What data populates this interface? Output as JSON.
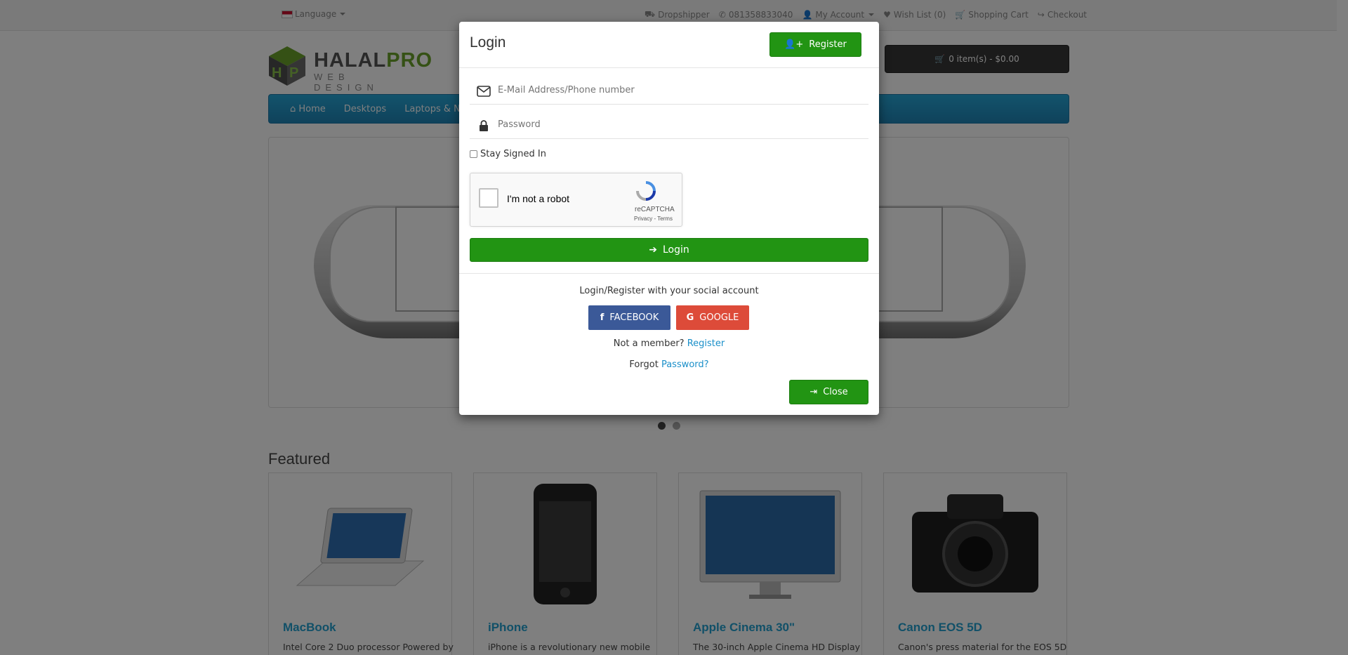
{
  "topbar": {
    "language": "Language",
    "dropshipper": "Dropshipper",
    "phone": "081358833040",
    "my_account": "My Account",
    "wishlist": "Wish List (0)",
    "shopping_cart": "Shopping Cart",
    "checkout": "Checkout"
  },
  "logo": {
    "word1": "HALAL",
    "word2": "PRO",
    "sub": "WEB DESIGN"
  },
  "cart": {
    "label": "0 item(s) - $0.00"
  },
  "menu": {
    "items": [
      "Home",
      "Desktops",
      "Laptops & Not"
    ]
  },
  "featured": {
    "title": "Featured",
    "products": [
      {
        "name": "MacBook",
        "desc": "Intel Core 2 Duo processor Powered by"
      },
      {
        "name": "iPhone",
        "desc": "iPhone is a revolutionary new mobile"
      },
      {
        "name": "Apple Cinema 30\"",
        "desc": "The 30-inch Apple Cinema HD Display"
      },
      {
        "name": "Canon EOS 5D",
        "desc": "Canon's press material for the EOS 5D"
      }
    ]
  },
  "modal": {
    "title": "Login",
    "register_label": "Register",
    "email_placeholder": "E-Mail Address/Phone number",
    "password_placeholder": "Password",
    "stay_signed_in": "Stay Signed In",
    "captcha": {
      "label": "I'm not a robot",
      "brand": "reCAPTCHA",
      "links": "Privacy - Terms"
    },
    "login_label": "Login",
    "social_text": "Login/Register with your social account",
    "facebook_label": "FACEBOOK",
    "google_label": "GOOGLE",
    "not_member": "Not a member?",
    "register_link": "Register",
    "forgot": "Forgot",
    "password_link": "Password?",
    "close_label": "Close"
  },
  "colors": {
    "green": "#229413",
    "facebook": "#3b5998",
    "google": "#dd4b39",
    "menu_blue": "#229ac8",
    "link": "#1a8fc9"
  }
}
